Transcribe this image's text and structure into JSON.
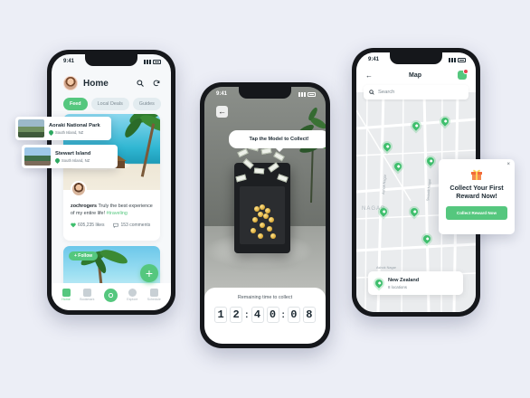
{
  "colors": {
    "accent": "#55c77e",
    "background": "#eceef6",
    "dark": "#15171b"
  },
  "phone_home": {
    "status_time": "9:41",
    "title": "Home",
    "tabs": [
      {
        "label": "Feed",
        "active": true
      },
      {
        "label": "Local Deals",
        "active": false
      },
      {
        "label": "Guides",
        "active": false
      }
    ],
    "post": {
      "username": "zochrogers",
      "text": " Truly the best experience of my entire life! ",
      "hashtag": "#traveling",
      "likes": "605,235 likes",
      "comments": "153 comments"
    },
    "follow_label": "+ Follow",
    "fab_label": "+",
    "nav": [
      {
        "label": "Home",
        "icon": "home-icon",
        "active": true
      },
      {
        "label": "Bookmark",
        "icon": "bookmark-icon",
        "active": false
      },
      {
        "label": "",
        "icon": "scan-icon",
        "active": false
      },
      {
        "label": "Explore",
        "icon": "compass-icon",
        "active": false
      },
      {
        "label": "Schedule",
        "icon": "calendar-icon",
        "active": false
      }
    ]
  },
  "floating_places": [
    {
      "title": "Aoraki National Park",
      "subtitle": "South Island, NZ"
    },
    {
      "title": "Stewart Island",
      "subtitle": "South Island, NZ"
    }
  ],
  "phone_ar": {
    "status_time": "9:41",
    "bubble_text": "Tap the Model to Collect!",
    "timer_label": "Remaining time to collect",
    "timer_digits": [
      "1",
      "2",
      "4",
      "0",
      "0",
      "8"
    ]
  },
  "phone_map": {
    "status_time": "9:41",
    "title": "Map",
    "search_placeholder": "Search",
    "location_card": {
      "title": "New Zealand",
      "subtitle": "8 locations"
    },
    "street_labels": [
      "NAGAR",
      "Ashok Nagar",
      "Swastik Nagar",
      "Ashok Nagar"
    ]
  },
  "reward_popup": {
    "title_line1": "Collect Your First",
    "title_line2": "Reward Now!",
    "button_label": "Collect Reward Now",
    "close_label": "×"
  }
}
